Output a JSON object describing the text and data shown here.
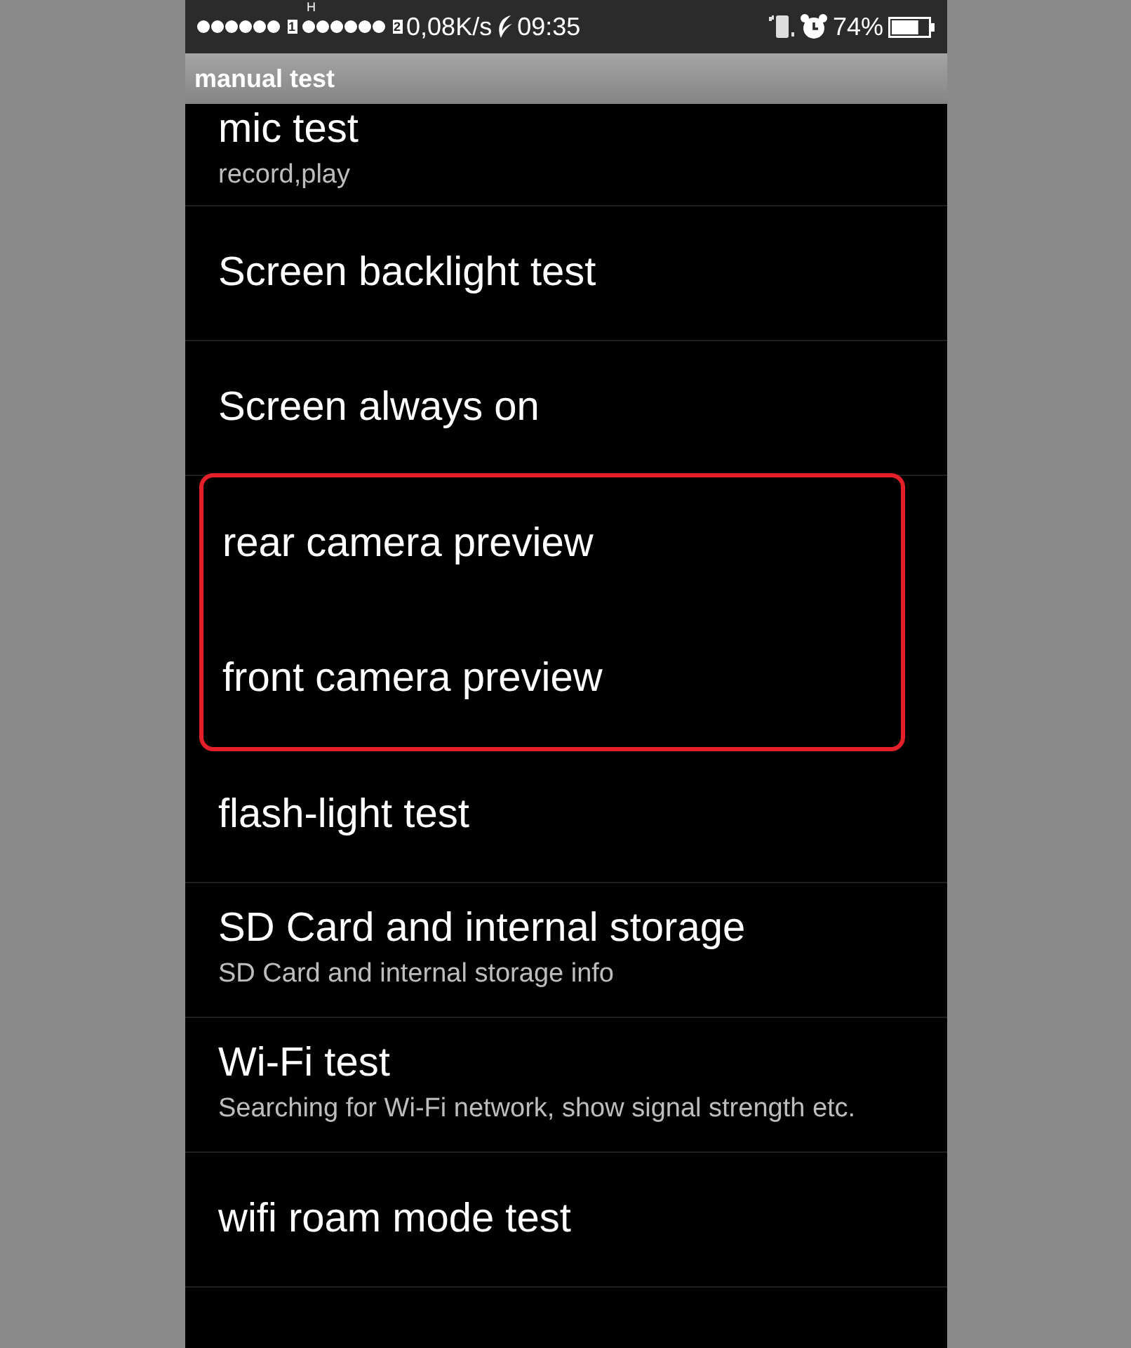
{
  "status_bar": {
    "network_type": "H",
    "sim1": "1",
    "sim2": "2",
    "speed": "0,08K/s",
    "time": "09:35",
    "battery": "74%",
    "level": 0.74
  },
  "header": {
    "title": "manual test"
  },
  "items": [
    {
      "title": "mic test",
      "subtitle": "record,play",
      "highlighted": false
    },
    {
      "title": "Screen backlight test",
      "highlighted": false
    },
    {
      "title": "Screen always on",
      "highlighted": false
    },
    {
      "title": "rear camera preview",
      "highlighted": true
    },
    {
      "title": "front camera preview",
      "highlighted": true
    },
    {
      "title": "flash-light test",
      "highlighted": false
    },
    {
      "title": "SD Card and internal storage",
      "subtitle": "SD Card and internal storage info",
      "highlighted": false
    },
    {
      "title": "Wi-Fi test",
      "subtitle": "Searching for Wi-Fi network, show signal strength etc.",
      "highlighted": false
    },
    {
      "title": "wifi roam mode test",
      "highlighted": false
    }
  ]
}
